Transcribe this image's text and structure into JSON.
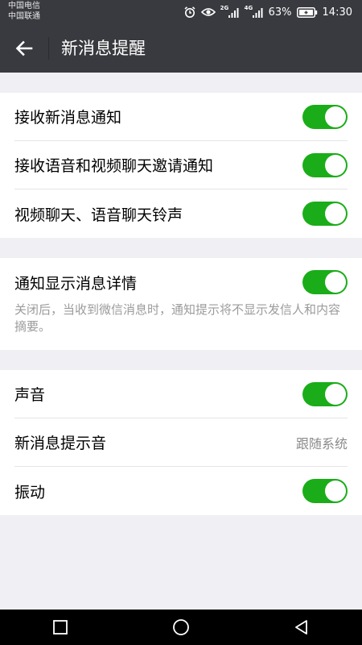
{
  "status_bar": {
    "carrier_1": "中国电信",
    "carrier_2": "中国联通",
    "network_1": "2G",
    "network_2": "4G",
    "battery": "63%",
    "time": "14:30"
  },
  "header": {
    "title": "新消息提醒"
  },
  "settings": {
    "group1": [
      {
        "label": "接收新消息通知",
        "enabled": true
      },
      {
        "label": "接收语音和视频聊天邀请通知",
        "enabled": true
      },
      {
        "label": "视频聊天、语音聊天铃声",
        "enabled": true
      }
    ],
    "group2": {
      "label": "通知显示消息详情",
      "enabled": true,
      "hint": "关闭后，当收到微信消息时，通知提示将不显示发信人和内容摘要。"
    },
    "group3": [
      {
        "label": "声音",
        "enabled": true
      },
      {
        "label": "新消息提示音",
        "value": "跟随系统"
      },
      {
        "label": "振动",
        "enabled": true
      }
    ]
  },
  "colors": {
    "toggle_on": "#1aad19",
    "bar_background": "#393a3f",
    "page_background": "#efeff4"
  }
}
